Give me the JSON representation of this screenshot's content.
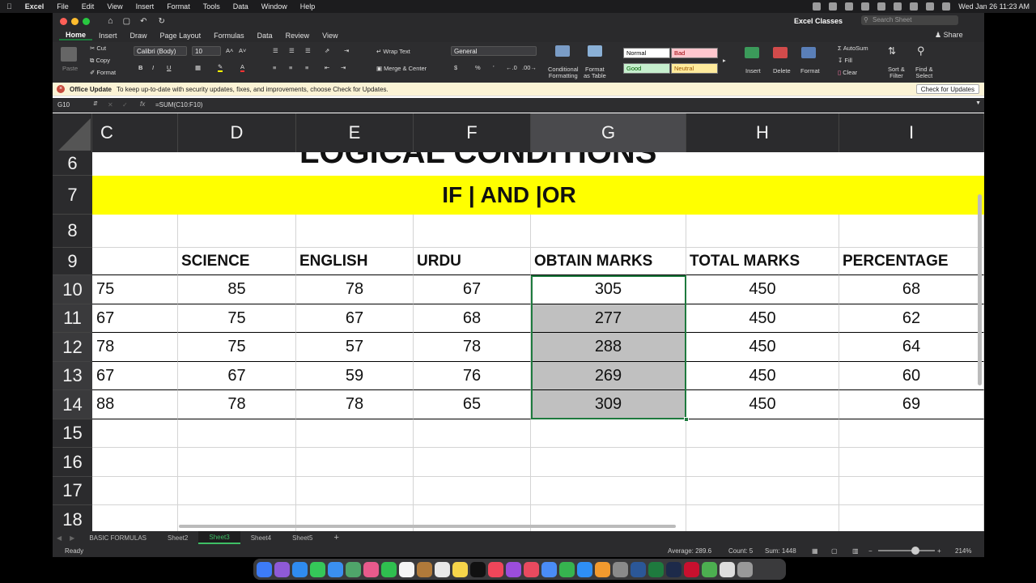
{
  "menubar": {
    "app": "Excel",
    "items": [
      "File",
      "Edit",
      "View",
      "Insert",
      "Format",
      "Tools",
      "Data",
      "Window",
      "Help"
    ],
    "clock": "Wed Jan 26  11:23 AM"
  },
  "window": {
    "doc_title": "Excel Classes",
    "search_placeholder": "Search Sheet",
    "share_label": "Share"
  },
  "ribbon": {
    "tabs": [
      "Home",
      "Insert",
      "Draw",
      "Page Layout",
      "Formulas",
      "Data",
      "Review",
      "View"
    ],
    "active_tab": "Home",
    "paste": "Paste",
    "cut": "Cut",
    "copy": "Copy",
    "format": "Format",
    "font_name": "Calibri (Body)",
    "font_size": "10",
    "bold": "B",
    "italic": "I",
    "underline": "U",
    "wrap_text": "Wrap Text",
    "merge_center": "Merge & Center",
    "number_format": "General",
    "currency": "$",
    "percent": "%",
    "conditional_formatting": [
      "Conditional",
      "Formatting"
    ],
    "format_as_table": [
      "Format",
      "as Table"
    ],
    "styles": [
      {
        "label": "Normal",
        "bg": "#ffffff",
        "fg": "#000000"
      },
      {
        "label": "Bad",
        "bg": "#ffc7ce",
        "fg": "#9c0006"
      },
      {
        "label": "Good",
        "bg": "#c6efce",
        "fg": "#006100"
      },
      {
        "label": "Neutral",
        "bg": "#ffeb9c",
        "fg": "#9c5700"
      }
    ],
    "insert": "Insert",
    "delete": "Delete",
    "format_cells": "Format",
    "autosum": "AutoSum",
    "fill": "Fill",
    "clear": "Clear",
    "sort_filter": [
      "Sort &",
      "Filter"
    ],
    "find_select": [
      "Find &",
      "Select"
    ]
  },
  "update_bar": {
    "title": "Office Update",
    "message": "To keep up-to-date with security updates, fixes, and improvements, choose Check for Updates.",
    "button": "Check for Updates"
  },
  "formula_bar": {
    "name_box": "G10",
    "fx": "fx",
    "formula": "=SUM(C10:F10)"
  },
  "columns": [
    "C",
    "D",
    "E",
    "F",
    "G",
    "H",
    "I"
  ],
  "rows": [
    "6",
    "7",
    "8",
    "9",
    "10",
    "11",
    "12",
    "13",
    "14",
    "15",
    "16",
    "17",
    "18"
  ],
  "sheet": {
    "title_partial": "LOGICAL CONDITIONS",
    "banner": "IF | AND |OR",
    "headers": [
      "",
      "SCIENCE",
      "ENGLISH",
      "URDU",
      "OBTAIN MARKS",
      "TOTAL MARKS",
      "PERCENTAGE"
    ],
    "data": [
      [
        "75",
        "85",
        "78",
        "67",
        "305",
        "450",
        "68"
      ],
      [
        "67",
        "75",
        "67",
        "68",
        "277",
        "450",
        "62"
      ],
      [
        "78",
        "75",
        "57",
        "78",
        "288",
        "450",
        "64"
      ],
      [
        "67",
        "67",
        "59",
        "76",
        "269",
        "450",
        "60"
      ],
      [
        "88",
        "78",
        "78",
        "65",
        "309",
        "450",
        "69"
      ]
    ]
  },
  "sheet_tabs": [
    "BASIC FORMULAS",
    "Sheet2",
    "Sheet3",
    "Sheet4",
    "Sheet5"
  ],
  "active_sheet": "Sheet3",
  "add_sheet": "+",
  "status": {
    "ready": "Ready",
    "average": "Average: 289.6",
    "count": "Count: 5",
    "sum": "Sum: 1448",
    "zoom": "214%"
  },
  "colors": {
    "accent": "#1e7a3e",
    "banner_yellow": "#ffff00",
    "selection_gray": "#c0c0c0"
  }
}
